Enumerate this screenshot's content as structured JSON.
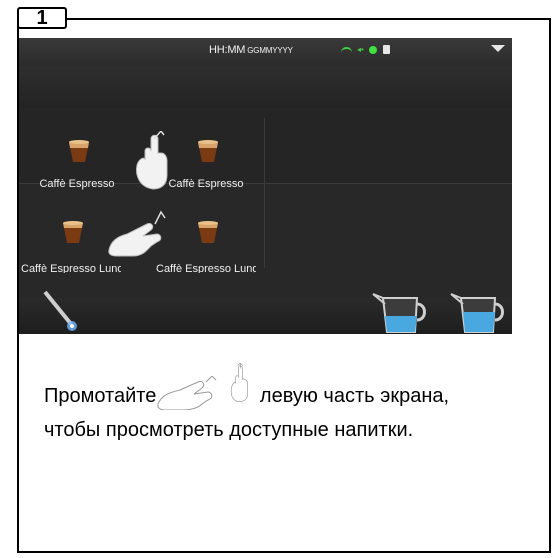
{
  "step": {
    "number": "1"
  },
  "screen": {
    "status": {
      "time": "HH:MM",
      "date": "GGMMYYYY"
    },
    "drinks": [
      {
        "label": "Caffè Espresso"
      },
      {
        "label": "Caffè Espresso"
      },
      {
        "label": "Caffè Espresso Lungo"
      },
      {
        "label": "Caffè Espresso Lungo"
      }
    ]
  },
  "instruction": {
    "text_before": "Промотайте",
    "text_after": " левую часть экрана, чтобы просмотреть доступные напитки."
  },
  "colors": {
    "status_green": "#3fe03f",
    "screen_bg": "#282828",
    "milk_blue": "#4aa8e0"
  },
  "icons": [
    "wifi-icon",
    "sound-icon",
    "status-dot",
    "tank-icon",
    "menu-arrow-icon",
    "espresso-cup-icon",
    "steam-wand-icon",
    "milk-pitcher-icon",
    "hand-swipe-icon"
  ]
}
